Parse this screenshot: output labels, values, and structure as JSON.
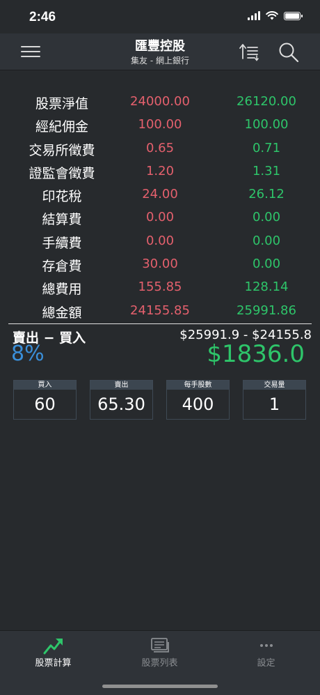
{
  "status": {
    "time": "2:46"
  },
  "nav": {
    "title": "匯豐控股",
    "subtitle": "集友 - 網上銀行"
  },
  "fees": [
    {
      "label": "股票淨值",
      "buy": "24000.00",
      "sell": "26120.00"
    },
    {
      "label": "經紀佣金",
      "buy": "100.00",
      "sell": "100.00"
    },
    {
      "label": "交易所徵費",
      "buy": "0.65",
      "sell": "0.71"
    },
    {
      "label": "證監會徵費",
      "buy": "1.20",
      "sell": "1.31"
    },
    {
      "label": "印花稅",
      "buy": "24.00",
      "sell": "26.12"
    },
    {
      "label": "結算費",
      "buy": "0.00",
      "sell": "0.00"
    },
    {
      "label": "手續費",
      "buy": "0.00",
      "sell": "0.00"
    },
    {
      "label": "存倉費",
      "buy": "30.00",
      "sell": "0.00"
    },
    {
      "label": "總費用",
      "buy": "155.85",
      "sell": "128.14"
    },
    {
      "label": "總金額",
      "buy": "24155.85",
      "sell": "25991.86"
    }
  ],
  "summary": {
    "label": "賣出 − 買入",
    "formula": "$25991.9 - $24155.8",
    "percent": "8%",
    "profit": "$1836.0"
  },
  "inputs": [
    {
      "label": "買入",
      "value": "60"
    },
    {
      "label": "賣出",
      "value": "65.30"
    },
    {
      "label": "每手股數",
      "value": "400"
    },
    {
      "label": "交易量",
      "value": "1"
    }
  ],
  "tabs": [
    {
      "label": "股票計算",
      "icon": "trend-up-icon",
      "active": true
    },
    {
      "label": "股票列表",
      "icon": "list-card-icon",
      "active": false
    },
    {
      "label": "設定",
      "icon": "more-dots-icon",
      "active": false
    }
  ],
  "colors": {
    "background": "#272a2d",
    "buy_value": "#e4606d",
    "sell_value": "#2ec56a",
    "percent": "#3a8fd9",
    "profit": "#2ec56a",
    "accent_tab": "#2ec56a"
  }
}
